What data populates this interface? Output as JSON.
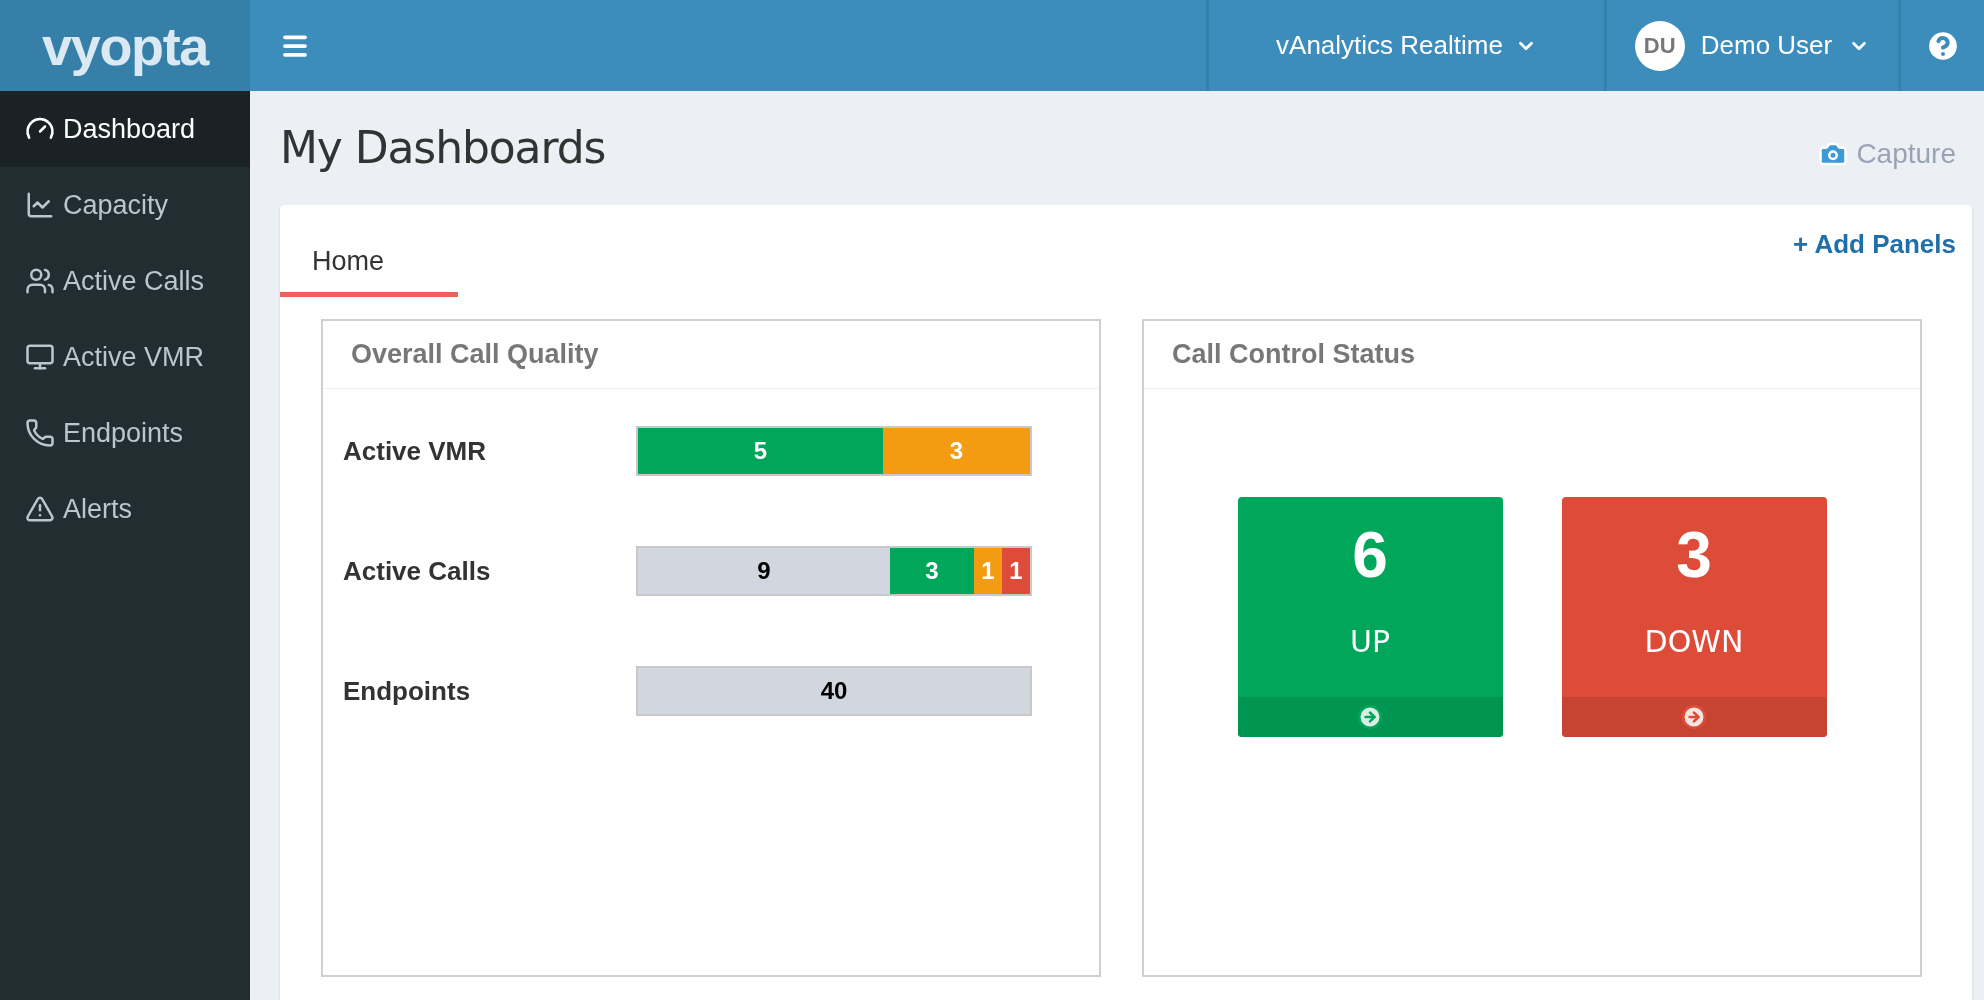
{
  "logo": "vyopta",
  "topbar": {
    "product": "vAnalytics Realtime",
    "user": {
      "initials": "DU",
      "name": "Demo User"
    }
  },
  "sidebar": {
    "items": [
      {
        "label": "Dashboard",
        "selected": true
      },
      {
        "label": "Capacity",
        "selected": false
      },
      {
        "label": "Active Calls",
        "selected": false
      },
      {
        "label": "Active VMR",
        "selected": false
      },
      {
        "label": "Endpoints",
        "selected": false
      },
      {
        "label": "Alerts",
        "selected": false
      }
    ]
  },
  "page": {
    "title": "My Dashboards",
    "capture": "Capture"
  },
  "tabs": [
    {
      "label": "Home",
      "selected": true
    }
  ],
  "add_panels": "+ Add Panels",
  "quality_panel": {
    "title": "Overall Call Quality",
    "rows": [
      {
        "label": "Active VMR",
        "segments": [
          {
            "value": "5",
            "color": "#00a65a"
          },
          {
            "value": "3",
            "color": "#f39c12"
          }
        ]
      },
      {
        "label": "Active Calls",
        "segments": [
          {
            "value": "9",
            "color": "#d2d6de"
          },
          {
            "value": "3",
            "color": "#00a65a"
          },
          {
            "value": "1",
            "color": "#f39c12"
          },
          {
            "value": "1",
            "color": "#dd4b39"
          }
        ]
      },
      {
        "label": "Endpoints",
        "segments": [
          {
            "value": "40",
            "color": "#d2d6de"
          }
        ]
      }
    ]
  },
  "status_panel": {
    "title": "Call Control Status",
    "tiles": [
      {
        "count": "6",
        "label": "UP",
        "color": "#00a65a"
      },
      {
        "count": "3",
        "label": "DOWN",
        "color": "#dd4b39"
      }
    ]
  }
}
